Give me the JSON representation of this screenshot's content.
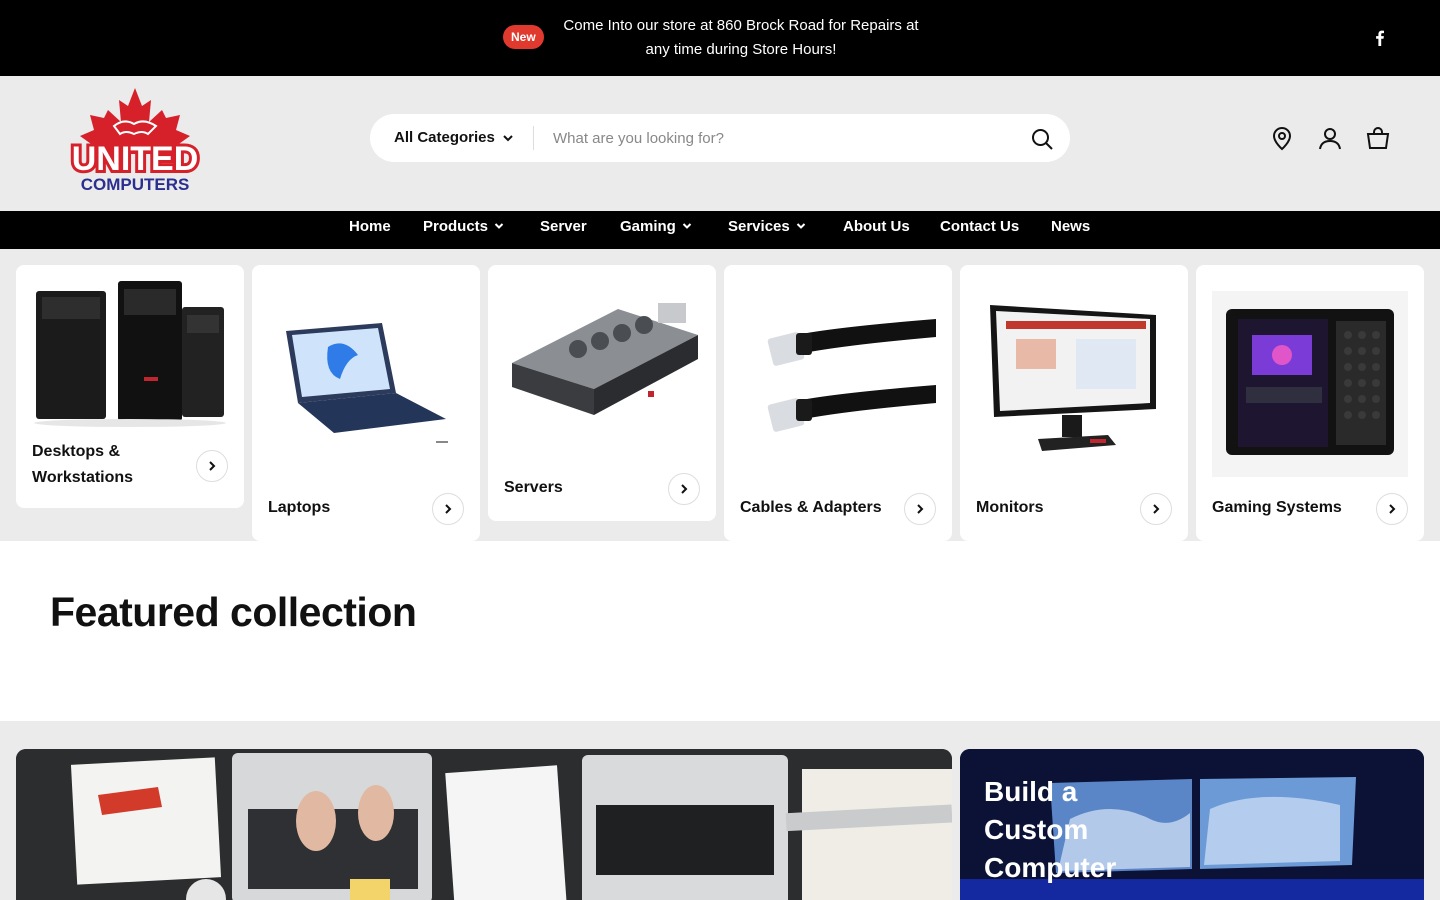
{
  "announcement": {
    "badge": "New",
    "message": "Come Into our store at 860 Brock Road for Repairs at any time during Store Hours!"
  },
  "icons": {
    "social": "facebook-icon",
    "location": "map-pin-icon",
    "account": "user-icon",
    "cart": "shopping-bag-icon",
    "search": "search-icon",
    "arrow": "chevron-right-icon"
  },
  "logo": {
    "line1": "UNITED",
    "line2": "COMPUTERS"
  },
  "search": {
    "category": "All Categories",
    "placeholder": "What are you looking for?"
  },
  "nav": [
    {
      "label": "Home"
    },
    {
      "label": "Products"
    },
    {
      "label": "Server"
    },
    {
      "label": "Gaming"
    },
    {
      "label": "Services"
    },
    {
      "label": "About Us"
    },
    {
      "label": "Contact Us"
    },
    {
      "label": "News"
    }
  ],
  "categories": [
    {
      "label": "Desktops & Workstations"
    },
    {
      "label": "Laptops"
    },
    {
      "label": "Servers"
    },
    {
      "label": "Cables & Adapters"
    },
    {
      "label": "Monitors"
    },
    {
      "label": "Gaming Systems"
    }
  ],
  "featured": {
    "title": "Featured collection"
  },
  "promo": {
    "title": "Build a Custom Computer"
  },
  "colors": {
    "accent": "#e03a2f",
    "logo_red": "#d6202a",
    "logo_blue": "#2b2f8f",
    "bar": "#000000",
    "header_bg": "#ebebeb"
  }
}
